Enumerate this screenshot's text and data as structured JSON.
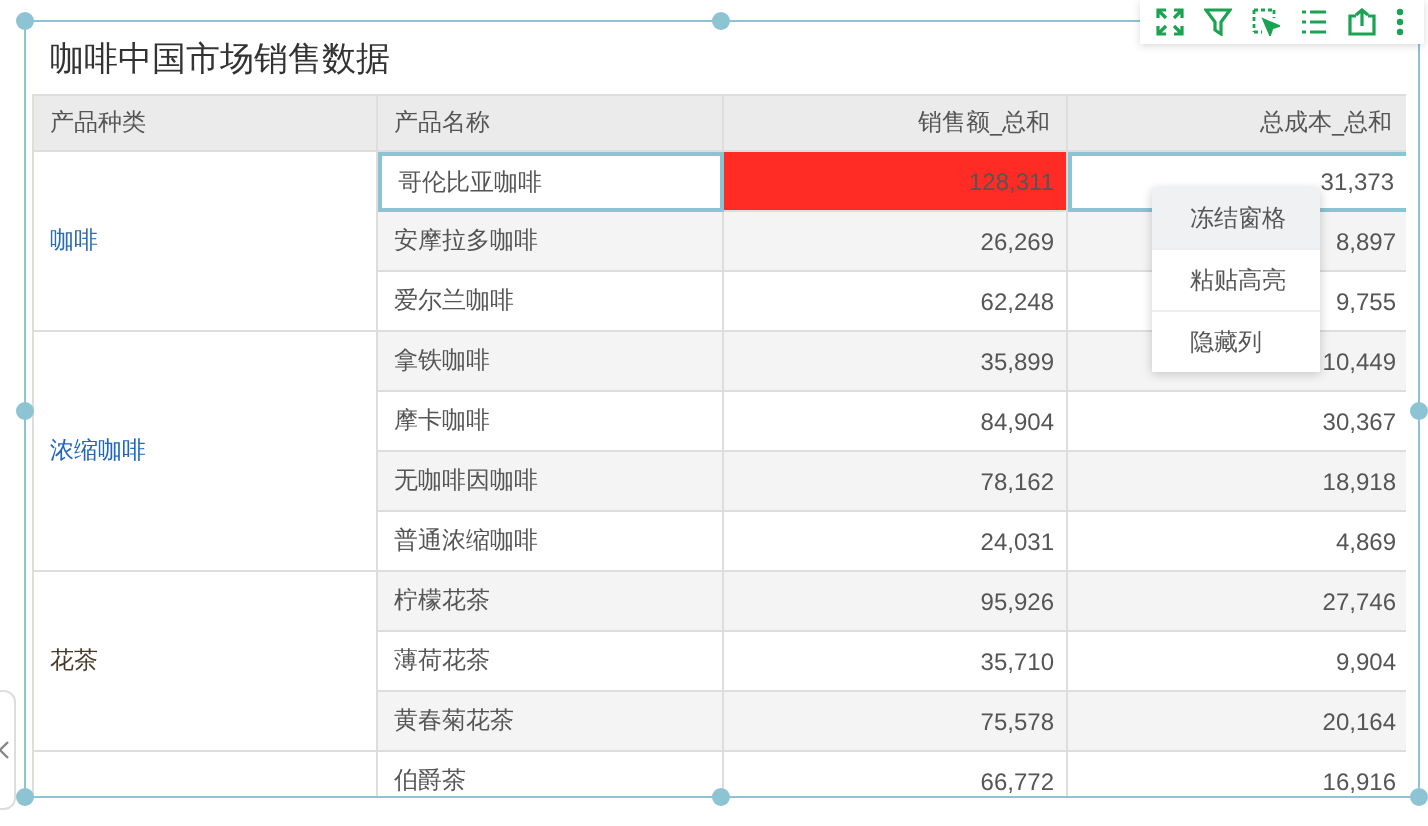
{
  "title": "咖啡中国市场销售数据",
  "columns": [
    "产品种类",
    "产品名称",
    "销售额_总和",
    "总成本_总和"
  ],
  "groups": [
    {
      "category": "咖啡",
      "color": "#2a6cb0",
      "rows": [
        {
          "product": "哥伦比亚咖啡",
          "sales": "128,311",
          "cost": "31,373",
          "selected": true,
          "color": "#ff2b24"
        },
        {
          "product": "安摩拉多咖啡",
          "sales": "26,269",
          "cost": "8,897",
          "selected": false
        },
        {
          "product": "爱尔兰咖啡",
          "sales": "62,248",
          "cost": "9,755",
          "selected": false
        }
      ]
    },
    {
      "category": "浓缩咖啡",
      "color": "#1f66c2",
      "rows": [
        {
          "product": "拿铁咖啡",
          "sales": "35,899",
          "cost": "10,449",
          "selected": false
        },
        {
          "product": "摩卡咖啡",
          "sales": "84,904",
          "cost": "30,367",
          "selected": false
        },
        {
          "product": "无咖啡因咖啡",
          "sales": "78,162",
          "cost": "18,918",
          "selected": false
        },
        {
          "product": "普通浓缩咖啡",
          "sales": "24,031",
          "cost": "4,869",
          "selected": false
        }
      ]
    },
    {
      "category": "花茶",
      "color": "#4a3a28",
      "rows": [
        {
          "product": "柠檬花茶",
          "sales": "95,926",
          "cost": "27,746",
          "selected": false
        },
        {
          "product": "薄荷花茶",
          "sales": "35,710",
          "cost": "9,904",
          "selected": false
        },
        {
          "product": "黄春菊花茶",
          "sales": "75,578",
          "cost": "20,164",
          "selected": false
        }
      ]
    },
    {
      "rows": [
        {
          "product": "伯爵茶",
          "sales": "66,772",
          "cost": "16,916",
          "selected": false
        }
      ]
    }
  ],
  "context_menu": [
    {
      "label": "冻结窗格",
      "selected": true
    },
    {
      "label": "粘贴高亮",
      "selected": false
    },
    {
      "label": "隐藏列",
      "selected": false
    }
  ]
}
